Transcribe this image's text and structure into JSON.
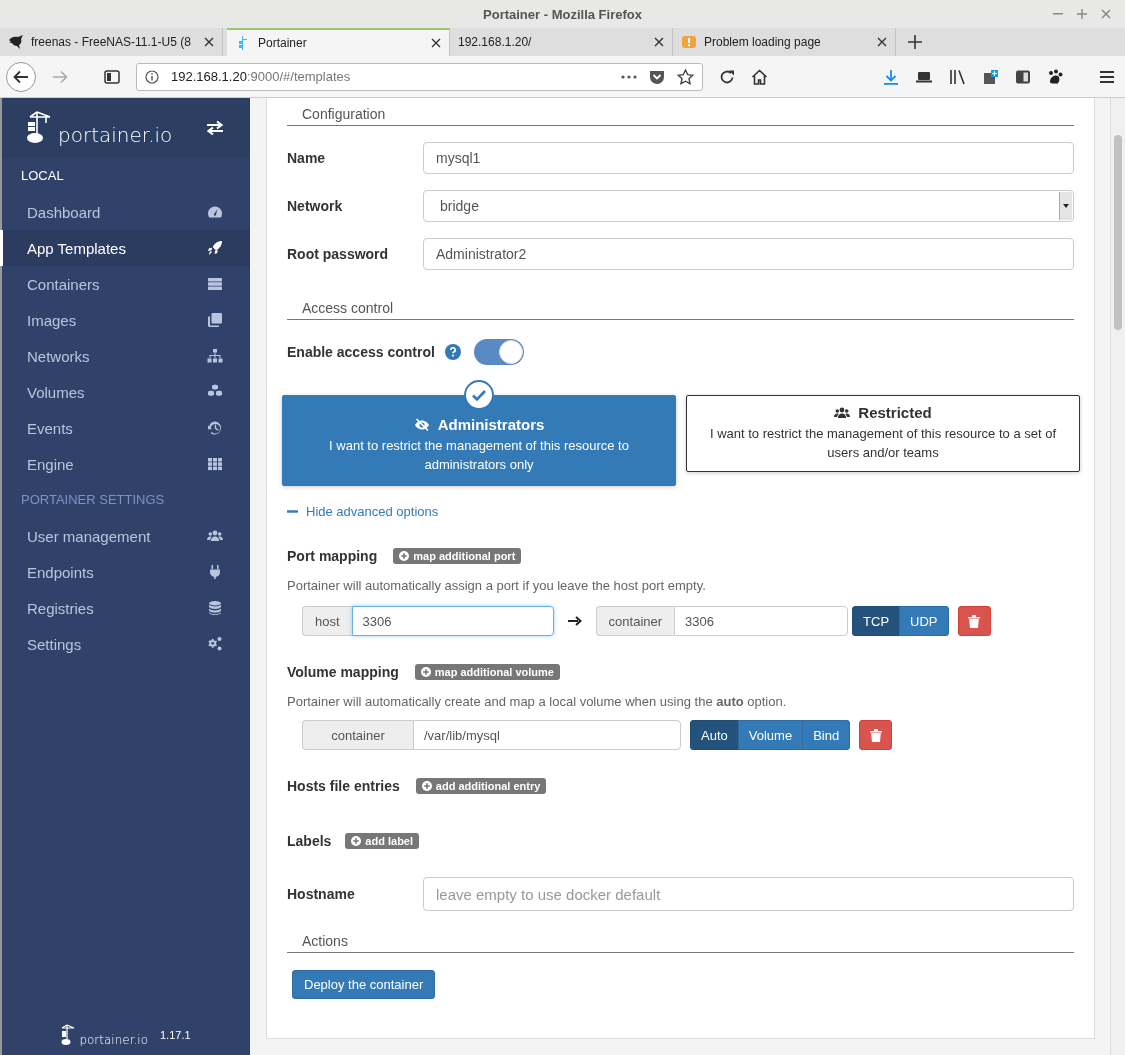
{
  "window": {
    "title": "Portainer - Mozilla Firefox"
  },
  "browser": {
    "tabs": [
      {
        "title": "freenas - FreeNAS-11.1-U5 (8",
        "kind": "freenas",
        "selected": false
      },
      {
        "title": "Portainer",
        "kind": "portainer",
        "selected": true
      },
      {
        "title": "192.168.1.20/",
        "kind": "blank",
        "selected": false
      },
      {
        "title": "Problem loading page",
        "kind": "error",
        "selected": false
      }
    ],
    "address": {
      "host": "192.168.1.20",
      "path": ":9000/#/templates"
    }
  },
  "sidebar": {
    "brand": "portainer.io",
    "sections": [
      {
        "heading": "LOCAL",
        "kind": "endpoint",
        "items": [
          {
            "label": "Dashboard",
            "kind": "gauge",
            "selected": false
          },
          {
            "label": "App Templates",
            "kind": "rocket",
            "selected": true
          },
          {
            "label": "Containers",
            "kind": "stack",
            "selected": false
          },
          {
            "label": "Images",
            "kind": "copies",
            "selected": false
          },
          {
            "label": "Networks",
            "kind": "hierarchy",
            "selected": false
          },
          {
            "label": "Volumes",
            "kind": "cubes",
            "selected": false
          },
          {
            "label": "Events",
            "kind": "history",
            "selected": false
          },
          {
            "label": "Engine",
            "kind": "grid",
            "selected": false
          }
        ]
      },
      {
        "heading": "PORTAINER SETTINGS",
        "kind": "settings",
        "items": [
          {
            "label": "User management",
            "kind": "users",
            "selected": false
          },
          {
            "label": "Endpoints",
            "kind": "plug",
            "selected": false
          },
          {
            "label": "Registries",
            "kind": "database",
            "selected": false
          },
          {
            "label": "Settings",
            "kind": "gears",
            "selected": false
          }
        ]
      }
    ],
    "footer": {
      "brand": "portainer.io",
      "version": "1.17.1"
    }
  },
  "configuration": {
    "heading": "Configuration",
    "fields": [
      {
        "label": "Name",
        "kind": "text",
        "value": "mysql1"
      },
      {
        "label": "Network",
        "kind": "select",
        "value": "bridge"
      },
      {
        "label": "Root password",
        "kind": "text",
        "value": "Administrator2"
      }
    ]
  },
  "access_control": {
    "heading": "Access control",
    "toggle": {
      "label": "Enable access control",
      "on": true
    },
    "options": [
      {
        "title": "Administrators",
        "kind": "eye-slash",
        "description": "I want to restrict the management of this resource to administrators only",
        "selected": true
      },
      {
        "title": "Restricted",
        "kind": "users",
        "description": "I want to restrict the management of this resource to a set of users and/or teams",
        "selected": false
      }
    ]
  },
  "advanced": {
    "link": "Hide advanced options",
    "expanded": true
  },
  "port_mapping": {
    "title": "Port mapping",
    "add_button": "map additional port",
    "help": "Portainer will automatically assign a port if you leave the host port empty.",
    "rows": [
      {
        "host_label": "host",
        "host": "3306",
        "focused": true,
        "container_label": "container",
        "container": "3306",
        "protocols": [
          {
            "label": "TCP",
            "selected": true
          },
          {
            "label": "UDP",
            "selected": false
          }
        ]
      }
    ]
  },
  "volume_mapping": {
    "title": "Volume mapping",
    "add_button": "map additional volume",
    "help": "Portainer will automatically create and map a local volume when using the **auto** option.",
    "rows": [
      {
        "label": "container",
        "path": "/var/lib/mysql",
        "types": [
          {
            "label": "Auto",
            "selected": true
          },
          {
            "label": "Volume",
            "selected": false
          },
          {
            "label": "Bind",
            "selected": false
          }
        ]
      }
    ]
  },
  "hosts_file": {
    "title": "Hosts file entries",
    "add_button": "add additional entry"
  },
  "labels": {
    "title": "Labels",
    "add_button": "add label"
  },
  "hostname": {
    "label": "Hostname",
    "placeholder": "leave empty to use docker default"
  },
  "actions": {
    "heading": "Actions",
    "deploy_button": "Deploy the container"
  }
}
